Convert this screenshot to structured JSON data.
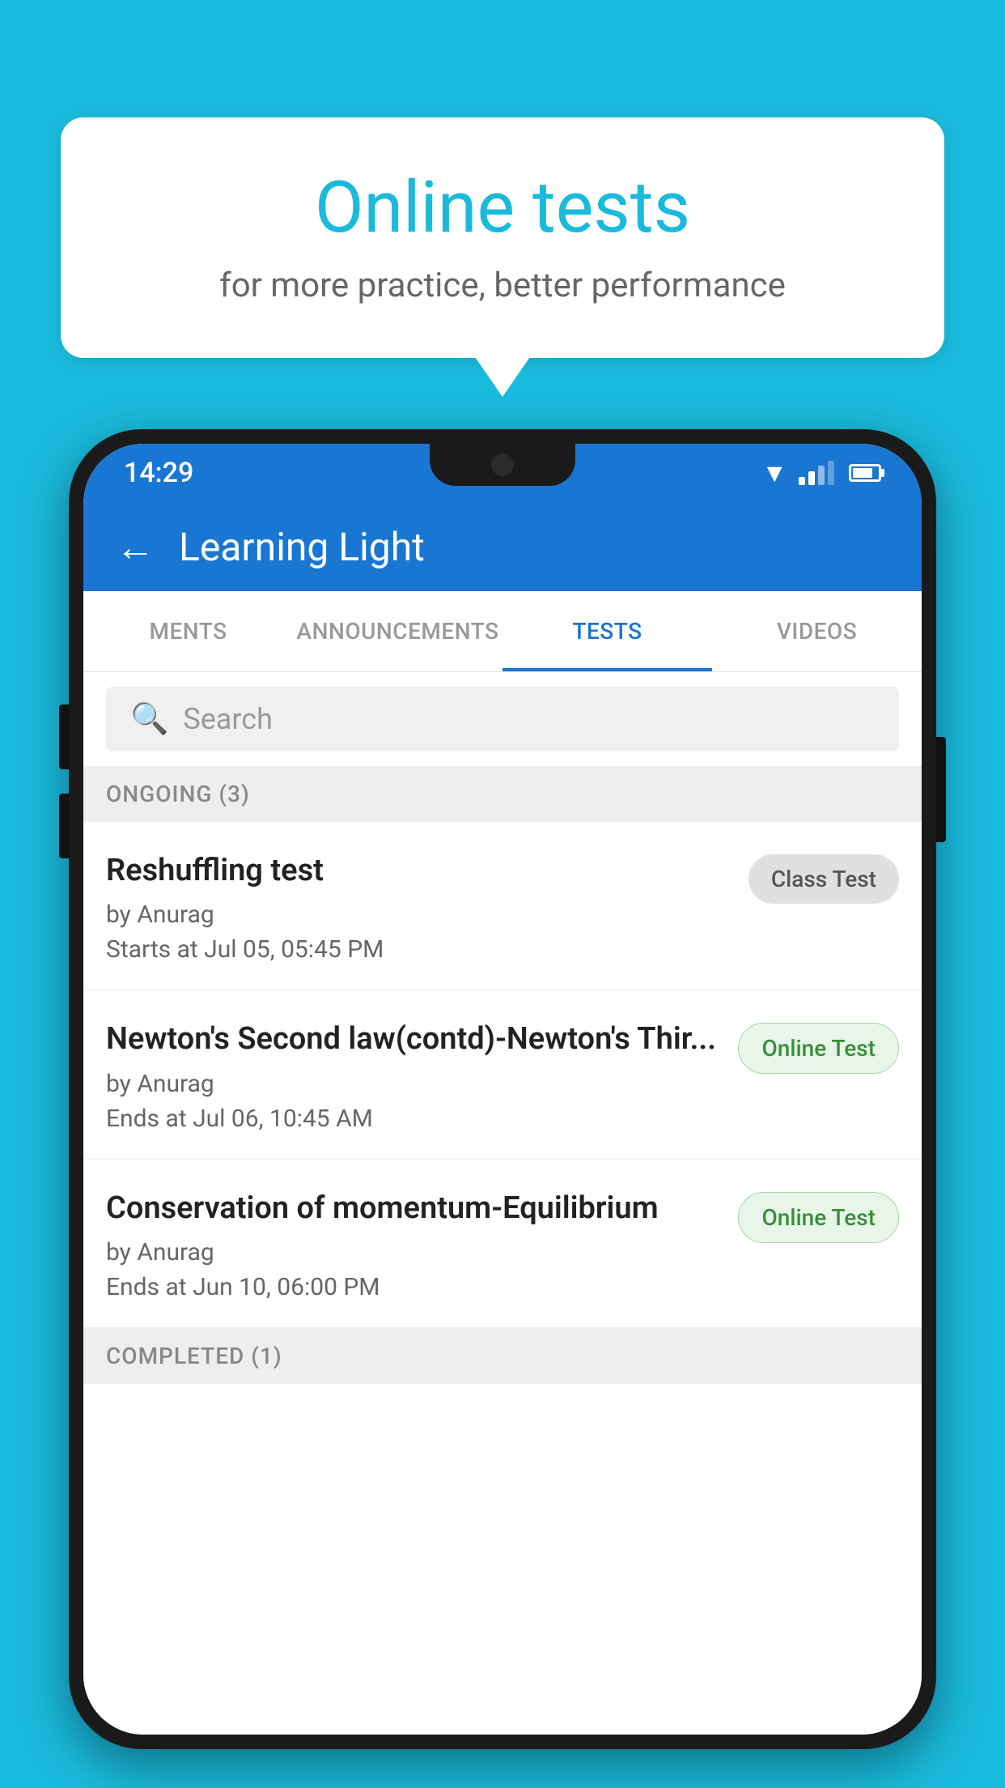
{
  "background_color": "#1ABADC",
  "speech_bubble": {
    "title": "Online tests",
    "subtitle": "for more practice, better performance"
  },
  "phone": {
    "status_bar": {
      "time": "14:29"
    },
    "app_header": {
      "title": "Learning Light",
      "back_label": "←"
    },
    "tabs": [
      {
        "label": "MENTS",
        "active": false
      },
      {
        "label": "ANNOUNCEMENTS",
        "active": false
      },
      {
        "label": "TESTS",
        "active": true
      },
      {
        "label": "VIDEOS",
        "active": false
      }
    ],
    "search": {
      "placeholder": "Search"
    },
    "ongoing_section": {
      "label": "ONGOING (3)",
      "tests": [
        {
          "name": "Reshuffling test",
          "author": "by Anurag",
          "time_label": "Starts at",
          "time": "Jul 05, 05:45 PM",
          "badge": "Class Test",
          "badge_type": "class"
        },
        {
          "name": "Newton's Second law(contd)-Newton's Thir...",
          "author": "by Anurag",
          "time_label": "Ends at",
          "time": "Jul 06, 10:45 AM",
          "badge": "Online Test",
          "badge_type": "online"
        },
        {
          "name": "Conservation of momentum-Equilibrium",
          "author": "by Anurag",
          "time_label": "Ends at",
          "time": "Jun 10, 06:00 PM",
          "badge": "Online Test",
          "badge_type": "online"
        }
      ]
    },
    "completed_section": {
      "label": "COMPLETED (1)"
    }
  }
}
